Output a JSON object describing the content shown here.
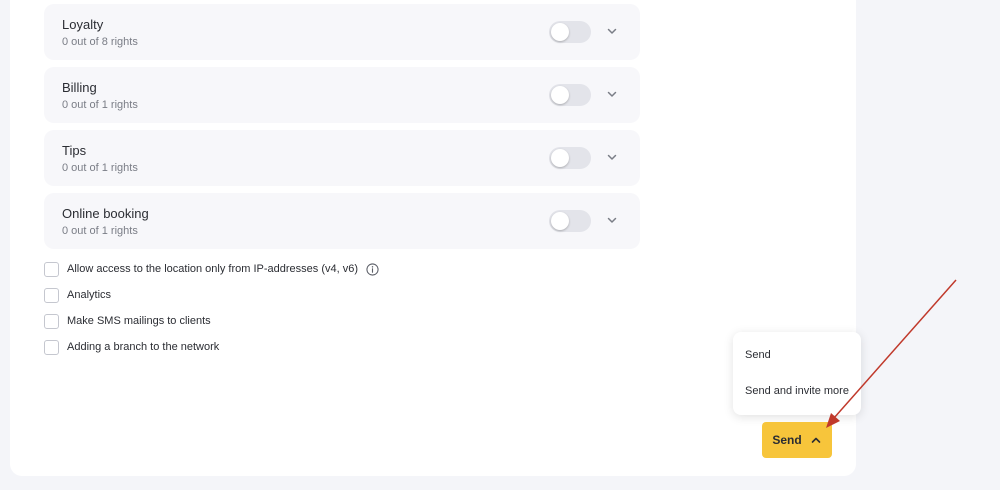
{
  "permissions": [
    {
      "title": "Loyalty",
      "subtitle": "0 out of 8 rights"
    },
    {
      "title": "Billing",
      "subtitle": "0 out of 1 rights"
    },
    {
      "title": "Tips",
      "subtitle": "0 out of 1 rights"
    },
    {
      "title": "Online booking",
      "subtitle": "0 out of 1 rights"
    }
  ],
  "checkboxes": [
    {
      "label": "Allow access to the location only from IP-addresses (v4, v6)",
      "checked": false,
      "has_info_icon": true
    },
    {
      "label": "Analytics",
      "checked": false
    },
    {
      "label": "Make SMS mailings to clients",
      "checked": false
    },
    {
      "label": "Adding a branch to the network",
      "checked": false
    }
  ],
  "send_menu": {
    "items": [
      "Send",
      "Send and invite more"
    ]
  },
  "send_button": {
    "label": "Send",
    "icon": "chevron-up-icon",
    "color": "#f7c53b"
  },
  "colors": {
    "accent": "#f7c53b",
    "annotation_arrow": "#c0392b"
  }
}
